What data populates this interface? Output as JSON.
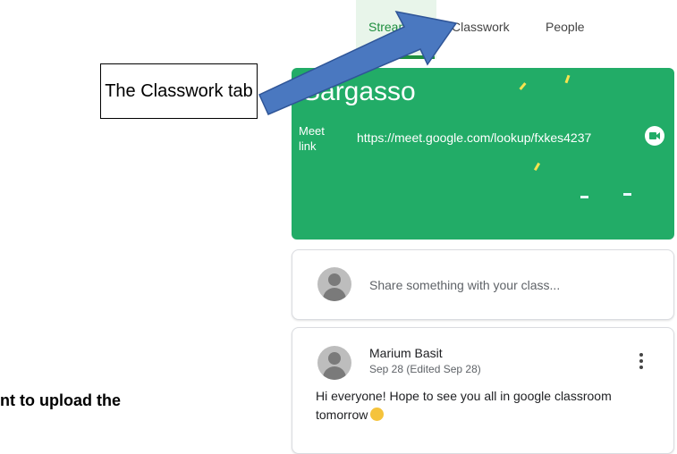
{
  "tabs": [
    {
      "label": "Stream"
    },
    {
      "label": "Classwork"
    },
    {
      "label": "People"
    }
  ],
  "banner": {
    "class_name": "Sargasso",
    "meet_label": "Meet link",
    "meet_url": "https://meet.google.com/lookup/fxkes4237",
    "color": "#22ac67"
  },
  "share": {
    "placeholder": "Share something with your class..."
  },
  "post": {
    "author": "Marium Basit",
    "date": "Sep 28 (Edited Sep 28)",
    "body": "Hi everyone! Hope to see you all in google classroom tomorrow"
  },
  "annotation": {
    "callout_text": "The Classwork tab",
    "arrow_color": "#4a78c0"
  },
  "document": {
    "partial_text": "nt to upload the"
  }
}
